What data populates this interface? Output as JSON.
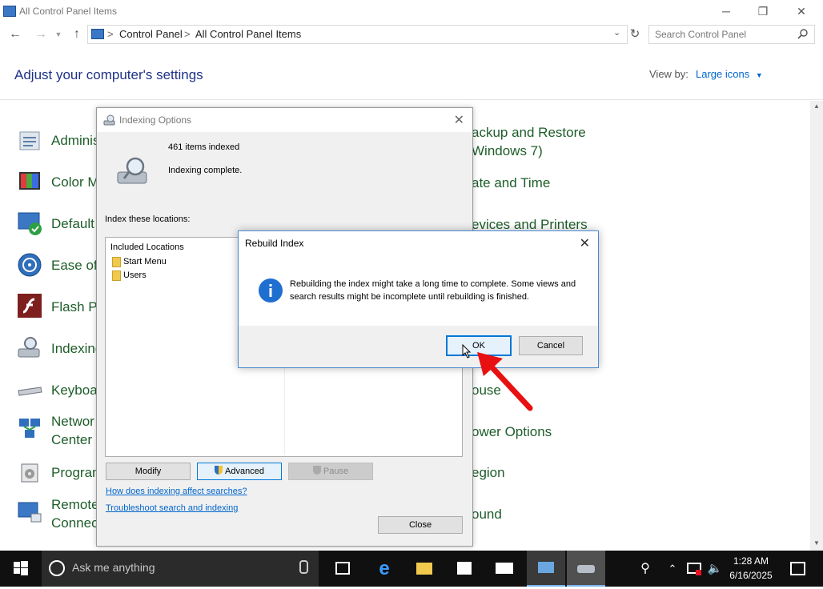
{
  "window": {
    "title": "All Control Panel Items",
    "minimize": "─",
    "maximize": "❐",
    "close": "✕"
  },
  "address": {
    "back": "←",
    "forward": "→",
    "up": "↑",
    "breadcrumbs": [
      "Control Panel",
      "All Control Panel Items"
    ],
    "separator": ">",
    "search_placeholder": "Search Control Panel"
  },
  "header": {
    "title": "Adjust your computer's settings",
    "view_by_label": "View by:",
    "view_by_value": "Large icons"
  },
  "left_items": [
    "Adminis",
    "Color M",
    "Default",
    "Ease of A",
    "Flash Pla",
    "Indexing",
    "Keyboar",
    "Networ",
    "Center",
    "Program",
    "Remote",
    "Connect"
  ],
  "right_items": [
    "ackup and Restore",
    "Windows 7)",
    "ate and Time",
    "evices and Printers",
    "ouse",
    "ower Options",
    "egion",
    "ound"
  ],
  "indexing_dialog": {
    "title": "Indexing Options",
    "items_indexed": "461 items indexed",
    "status": "Indexing complete.",
    "locations_label": "Index these locations:",
    "list_header": "Included Locations",
    "locations": [
      "Start Menu",
      "Users"
    ],
    "buttons": {
      "modify": "Modify",
      "advanced": "Advanced",
      "pause": "Pause",
      "close": "Close"
    },
    "links": [
      "How does indexing affect searches?",
      "Troubleshoot search and indexing"
    ]
  },
  "rebuild_dialog": {
    "title": "Rebuild Index",
    "message": "Rebuilding the index might take a long time to complete. Some views and search results might be incomplete until rebuilding is finished.",
    "ok": "OK",
    "cancel": "Cancel"
  },
  "taskbar": {
    "search_text": "Ask me anything",
    "time": "1:28 AM",
    "date": "6/16/2025"
  },
  "colors": {
    "accent": "#0078d7",
    "link": "#0066cc",
    "item_text": "#1e5d2a",
    "annotation_arrow": "#e81010"
  }
}
